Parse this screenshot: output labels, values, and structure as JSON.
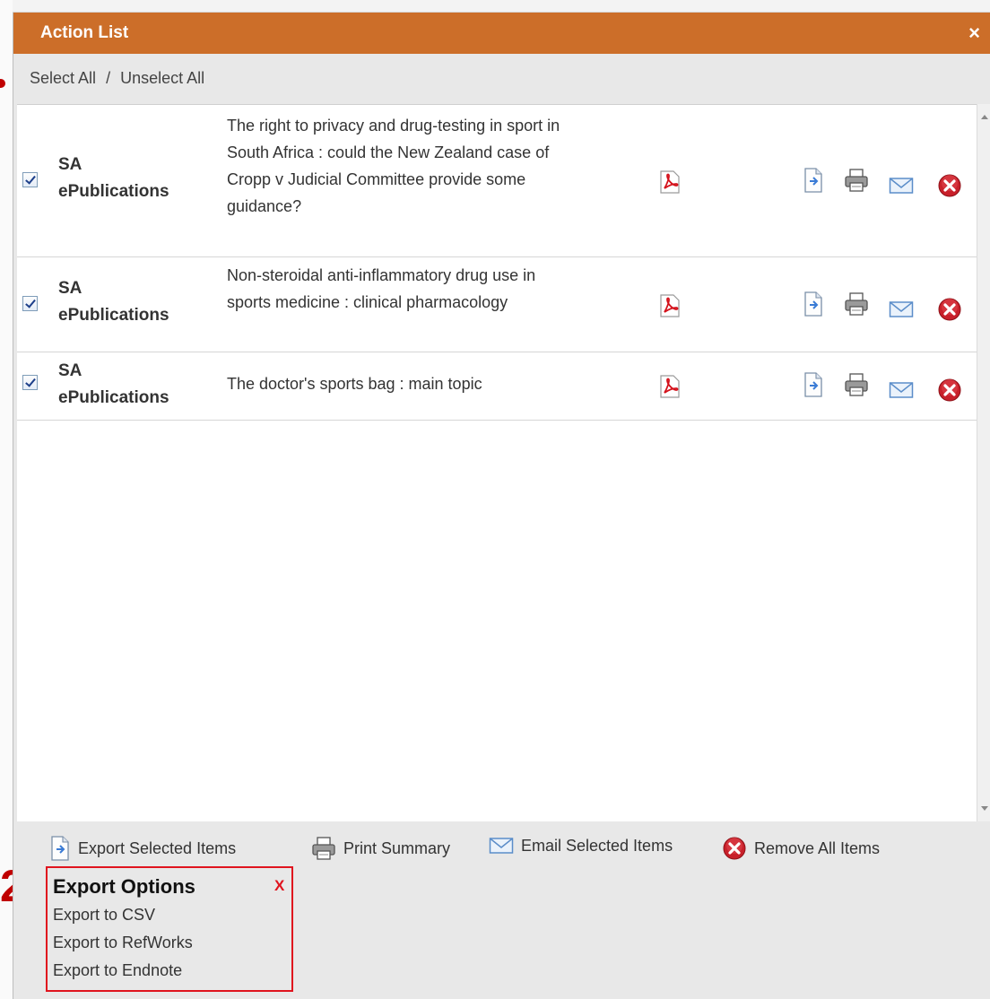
{
  "dialog": {
    "title": "Action List",
    "close_glyph": "×"
  },
  "select": {
    "select_all": "Select All",
    "separator": "/",
    "unselect_all": "Unselect All"
  },
  "rows": [
    {
      "checked": true,
      "source_line1": "SA",
      "source_line2": "ePublications",
      "title": "The right to privacy and drug-testing in sport in South Africa : could the New Zealand case of Cropp v Judicial Committee provide some guidance?"
    },
    {
      "checked": true,
      "source_line1": "SA",
      "source_line2": "ePublications",
      "title": "Non-steroidal anti-inflammatory drug use in sports medicine : clinical pharmacology"
    },
    {
      "checked": true,
      "source_line1": "SA",
      "source_line2": "ePublications",
      "title": "The doctor's sports bag : main topic"
    }
  ],
  "row_icons": [
    "pdf-icon",
    "export-icon",
    "print-icon",
    "email-icon",
    "remove-icon"
  ],
  "footer": {
    "export_selected": "Export Selected Items",
    "print_summary": "Print Summary",
    "email_selected": "Email Selected Items",
    "remove_all": "Remove All Items"
  },
  "export_options": {
    "heading": "Export Options",
    "close": "X",
    "items": [
      "Export to CSV",
      "Export to RefWorks",
      "Export to Endnote"
    ]
  },
  "annotation": {
    "number": "2"
  },
  "colors": {
    "titlebar": "#cc6e29",
    "highlight_border": "#e0141e",
    "annotation": "#c00000"
  }
}
